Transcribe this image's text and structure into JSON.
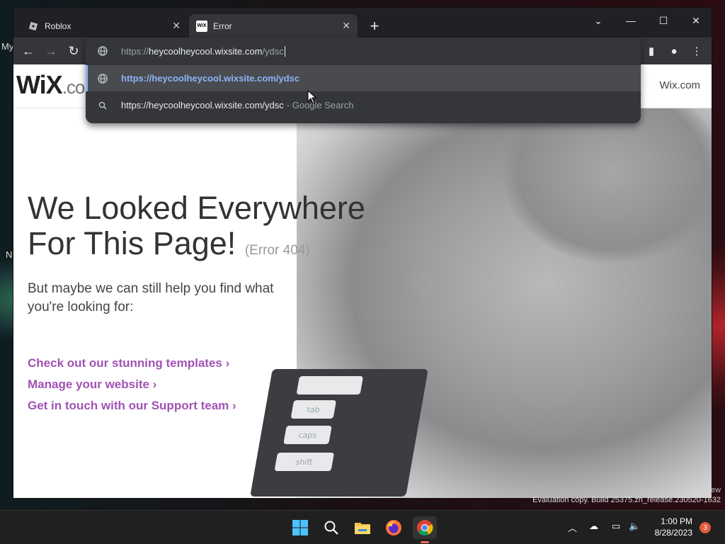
{
  "desktop": {
    "left_text_1": "My",
    "left_text_2": "N",
    "watermark": "Evaluation copy. Build 25375.zn_release.230520-1632",
    "watermark_tail": "ew"
  },
  "browser": {
    "tabs": [
      {
        "title": "Roblox",
        "favicon": "roblox-icon"
      },
      {
        "title": "Error",
        "favicon": "wix-icon",
        "favicon_text": "WiX"
      }
    ],
    "omnibox": {
      "scheme": "https://",
      "host": "heycoolheycool.wixsite.com",
      "path": "/ydsc",
      "suggestions": [
        {
          "text": "https://heycoolheycool.wixsite.com/ydsc",
          "hint": ""
        },
        {
          "text": "https://heycoolheycool.wixsite.com/ydsc",
          "hint": "- Google Search"
        }
      ]
    }
  },
  "page": {
    "logo": "WiX",
    "logo_suffix": ".co",
    "header_link": "Wix.com",
    "headline_line1": "We Looked Everywhere",
    "headline_line2": "For This Page!",
    "error_code": "(Error 404)",
    "subtext": "But maybe we can still help you find what you're looking for:",
    "links": [
      {
        "label": "Check out our stunning templates ›"
      },
      {
        "label": "Manage your website ›"
      },
      {
        "label": "Get in touch with our Support team ›"
      }
    ],
    "keys": [
      "tab",
      "caps",
      "shift"
    ]
  },
  "taskbar": {
    "time": "1:00 PM",
    "date": "8/28/2023",
    "notification_count": "3"
  },
  "colors": {
    "link_purple": "#a152b5",
    "omnibox_selected_link": "#8ab4f8",
    "taskbar_bg": "#202020"
  }
}
